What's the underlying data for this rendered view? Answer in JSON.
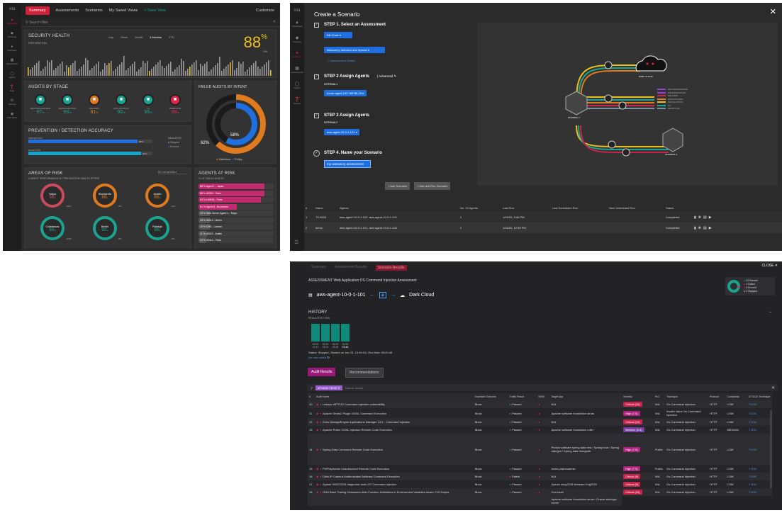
{
  "dash": {
    "logo": "ixia",
    "rail": [
      "Dashboard",
      "Topology",
      "Scenarios",
      "Assessment",
      "Agents",
      "Help",
      "Settings",
      "Dark Mode"
    ],
    "tabs": [
      "Summary",
      "Assessments",
      "Scenarios",
      "My Saved Views",
      "+ Save View"
    ],
    "customize": "Customize",
    "search_placeholder": "Search filter",
    "health": {
      "title": "SECURITY HEALTH",
      "subtitle": "PREVENTION",
      "ranges": [
        "Day",
        "Week",
        "Month",
        "6 Months",
        "YTD"
      ],
      "active_range": "6 Months",
      "score": "88",
      "unit": "%",
      "delta": "0%"
    },
    "audits_stage": {
      "title": "AUDITS BY STAGE",
      "items": [
        {
          "name": "RECONNAISSANCE",
          "pct": "97",
          "color": "#1aa38f"
        },
        {
          "name": "WEAPONIZATION",
          "pct": "93",
          "color": "#1aa38f"
        },
        {
          "name": "DELIVERY",
          "pct": "81",
          "color": "#e07a1f"
        },
        {
          "name": "EXPLOITATION",
          "pct": "90",
          "color": "#1aa38f"
        },
        {
          "name": "C2",
          "pct": "96",
          "color": "#1aa38f"
        },
        {
          "name": "OBJECTIVE",
          "pct": "38",
          "color": "#e0254a"
        }
      ]
    },
    "failed_intent": {
      "title": "FAILED AUDITS BY INTENT",
      "inner": "58%",
      "outer": "62%",
      "legend": [
        "Malicious",
        "Policy"
      ]
    },
    "accuracy": {
      "title": "PREVENTION / DETECTION ACCURACY",
      "rows": [
        {
          "label": "PREVENTION",
          "value": "88%",
          "pct": 0.88,
          "color": "#1f6fe0"
        },
        {
          "label": "DETECTION",
          "value": "91%",
          "pct": 0.91,
          "color": "#1aa3c9"
        }
      ],
      "legend_title": "INDICATOR",
      "legend": [
        "Skipped",
        "Errored"
      ]
    },
    "areas": {
      "title": "AREAS OF RISK",
      "subtitle": "LOWEST PERFORMANCE BY PREVENTION HEALTH SCORE",
      "filter": "BY LOCATION",
      "cities": [
        {
          "name": "Tokyo",
          "pct": "58",
          "delta": "-51%",
          "color": "#c84a5f"
        },
        {
          "name": "Bucharest",
          "pct": "88",
          "delta": "0%",
          "color": "#e07a1f"
        },
        {
          "name": "Austin",
          "pct": "88",
          "delta": "+0%",
          "color": "#e07a1f"
        },
        {
          "name": "Calabasas",
          "pct": "86",
          "delta": "+21%",
          "color": "#1aa38f"
        },
        {
          "name": "Berlin",
          "pct": "92",
          "delta": "0%",
          "color": "#1aa38f"
        },
        {
          "name": "Raleigh",
          "pct": "98",
          "delta": "-1%",
          "color": "#1aa38f"
        }
      ]
    },
    "agents_risk": {
      "title": "AGENTS AT RISK",
      "subtitle": "% OF FAILED AUDITS",
      "rows": [
        {
          "pct": "88 %",
          "name": "Agent 1 - Japan",
          "color": "#c22a6f",
          "fill": 0.88
        },
        {
          "pct": "88 %",
          "name": "d3000 - Paris",
          "color": "#c22a6f",
          "fill": 0.88
        },
        {
          "pct": "83 %",
          "name": "UDR45 - Paris",
          "color": "#c22a6f",
          "fill": 0.83
        },
        {
          "pct": "51 %",
          "name": "Agent 8 - Bucharest",
          "color": "#c22a6f",
          "fill": 0.51
        },
        {
          "pct": "15 %",
          "name": "Web Server Agent 1 - Tokyo",
          "color": "#555",
          "fill": 0.15
        },
        {
          "pct": "15 %",
          "name": "d2013 - Berlin",
          "color": "#555",
          "fill": 0.15
        },
        {
          "pct": "15 %",
          "name": "DHD - London",
          "color": "#555",
          "fill": 0.15
        },
        {
          "pct": "11 %",
          "name": "d3013 - Austin",
          "color": "#555",
          "fill": 0.11
        },
        {
          "pct": "10 %",
          "name": "d3414 - Paris",
          "color": "#555",
          "fill": 0.1
        }
      ]
    }
  },
  "scenario": {
    "logo": "ixia",
    "title": "Create a Scenario",
    "rail": [
      "Dashboard",
      "Topology",
      "Scenarios",
      "Assessments",
      "Agents",
      "Settings"
    ],
    "step1": {
      "title": "STEP 1.  Select an Assessment",
      "dd1": "Kill Chain",
      "dd2": "WannaCry Infection and Spread",
      "link": "Assessment Details"
    },
    "step2": {
      "title": "STEP 2  Assign Agents",
      "advanced": "Advanced",
      "label": "INTERNAL1",
      "dd": "home-agent-192-168-86-25"
    },
    "step3": {
      "title": "STEP 3  Assign Agents",
      "label": "INTERNAL2",
      "dd": "aws-agent-10-0-1-101"
    },
    "step4": {
      "title": "STEP 4.  Name your Scenario",
      "value": "my wannacry assessment"
    },
    "add_btn": "+ Add Scenario",
    "add_run_btn": "+ Add and Run Scenario",
    "diagram": {
      "cloud": "DARK CLOUD",
      "n1": "INTERNAL 1",
      "n2": "INTERNAL 2",
      "legend": [
        "RECONNAISSANCE",
        "WEAPONIZATION",
        "DELIVERY",
        "EXPLOITATION",
        "INSTALLATION",
        "C2",
        "OBJECTIVE"
      ]
    },
    "table": {
      "headers": [
        "#",
        "Name",
        "Agents",
        "No. Of Agents",
        "Last Run",
        "Last Scheduled Run",
        "Next Scheduled Run",
        "Status"
      ],
      "rows": [
        [
          "1",
          "TS 6003",
          "aws-agent-10-0-1-102, aws-agent-10-0-1-101",
          "2",
          "1/16/20, 9:36 PM",
          "",
          "",
          "Completed"
        ],
        [
          "2",
          "demo",
          "aws-agent-10-0-1-101, aws-agent-10-0-1-102",
          "2",
          "1/16/20, 12:59 PM",
          "",
          "",
          "Completed"
        ]
      ]
    }
  },
  "results": {
    "tabs": [
      "Summary",
      "Assessment Results",
      "Scenario Results"
    ],
    "close": "CLOSE",
    "assessment_title": "ASSESSMENT  Web Application OS Command Injection Assessment",
    "agent": "aws-agent-10-0-1-101",
    "target": "Dark Cloud",
    "summary": [
      {
        "text": "23 Passed",
        "color": "#1aa38f"
      },
      {
        "text": "1 Failed",
        "color": "#e0254a"
      },
      {
        "text": "0 Errored",
        "color": "#9b3fd0"
      },
      {
        "text": "0 Skipped",
        "color": "#ccc"
      }
    ],
    "history": {
      "title": "HISTORY",
      "subtitle": "RESULTS BY RUN",
      "bars": [
        {
          "date": "01/19",
          "time": "22:47",
          "h": 1
        },
        {
          "date": "01/19",
          "time": "23:13",
          "h": 1
        },
        {
          "date": "01/19",
          "time": "23:35",
          "h": 1
        },
        {
          "date": "01/22",
          "time": "15:46",
          "h": 1
        }
      ],
      "status": "Status: Stopped  |  Started on Jan 23, 15:46:31  |  Run time: 00:20:48",
      "no_new": "No new audits"
    },
    "btn_audit": "Audit Results",
    "btn_reco": "Recommendations",
    "filter_tag": "ATTACK T1190",
    "filter_placeholder": "Narrow results",
    "headers": [
      "#",
      "Audit Name",
      "Expected Outcome",
      "Traffic Result",
      "SIEM",
      "Target App",
      "Severity",
      "PoC",
      "Technique",
      "Protocol",
      "Complexity",
      "ATT&CK Technique"
    ],
    "rows": [
      {
        "n": "10",
        "name": "Linksys WRT110 Command Injection vulnerability",
        "exp": "Block",
        "res": "Passed",
        "app": "N/A",
        "sev": "Critical (10)",
        "sevc": "#c8234a",
        "poc": "N/A",
        "tech": "Os Command Injection",
        "proto": "HTTP",
        "cx": "LOW",
        "att": "T1190"
      },
      {
        "n": "11",
        "name": "Apache Struts2 Plugin OGNL Command Execution",
        "exp": "Block",
        "res": "Passed",
        "app": "Apache software foundation struts",
        "sev": "High (7.5)",
        "sevc": "#b0237f",
        "poc": "N/A",
        "tech": "Invalid Value Os Command Injection",
        "proto": "HTTP",
        "cx": "LOW",
        "att": "T1190"
      },
      {
        "n": "12",
        "name": "Zoho ManageEngine Applications Manager 13.5 - Command Injection",
        "exp": "Block",
        "res": "Passed",
        "app": "N/A",
        "sev": "Critical (10)",
        "sevc": "#c8234a",
        "poc": "N/A",
        "tech": "Os Command Injection",
        "proto": "HTTP",
        "cx": "LOW",
        "att": "T1190"
      },
      {
        "n": "13",
        "name": "Apache Roller OGNL Injection Remote Code Execution",
        "exp": "Block",
        "res": "Passed",
        "app": "Apache software foundation roller",
        "sev": "Medium (6.8)",
        "sevc": "#7a3fa0",
        "poc": "N/A",
        "tech": "Os Command Injection",
        "proto": "HTTP",
        "cx": "MEDIUM",
        "att": "T1190"
      },
      {
        "n": "14",
        "name": "Spring Data Commons Remote Code Execution",
        "exp": "Block",
        "res": "Passed",
        "app": "Pivotal software spring data rest / Spring boot / Spring data jpa / Spring data mongodb",
        "sev": "High (7.5)",
        "sevc": "#b0237f",
        "poc": "Public",
        "tech": "Os Command Injection",
        "proto": "HTTP",
        "cx": "LOW",
        "att": "T1190"
      },
      {
        "n": "15",
        "name": "PHPMyAdmin Unauthorized Remote Code Execution",
        "exp": "Block",
        "res": "Passed",
        "app": "Avina phpmoadmin",
        "sev": "High (7.5)",
        "sevc": "#b0237f",
        "poc": "Public",
        "tech": "Os Command Injection",
        "proto": "HTTP",
        "cx": "LOW",
        "att": "T1190"
      },
      {
        "n": "16",
        "name": "Dlink IP Camera Authenticated Arbitrary Command Execution",
        "exp": "Block",
        "res": "Failed",
        "app": "N/A",
        "sev": "Critical (9)",
        "sevc": "#c8234a",
        "poc": "N/A",
        "tech": "Os Command Injection",
        "proto": "HTTP",
        "cx": "LOW",
        "att": "T1190"
      },
      {
        "n": "17",
        "name": "Zpanel 09/02/2016 diagnostic tools OS Command Injection",
        "exp": "Block",
        "res": "Passed",
        "app": "Zpanel zeng2016 firmware Eng2020",
        "sev": "Critical (9)",
        "sevc": "#c8234a",
        "poc": "N/A",
        "tech": "Os Command Injection",
        "proto": "HTTP",
        "cx": "LOW",
        "att": "T1190"
      },
      {
        "n": "18",
        "name": "GNU Bash Trailing Characters After Function Definitions in Environment Variables Aware CGI Scripts",
        "exp": "Block",
        "res": "Passed",
        "app": "Gnu bash",
        "sev": "Critical (10)",
        "sevc": "#c8234a",
        "poc": "N/A",
        "tech": "Os Command Injection",
        "proto": "HTTP",
        "cx": "LOW",
        "att": "T1190"
      }
    ],
    "last_app": "Apache software foundation struts / Oracle weblogic server"
  }
}
